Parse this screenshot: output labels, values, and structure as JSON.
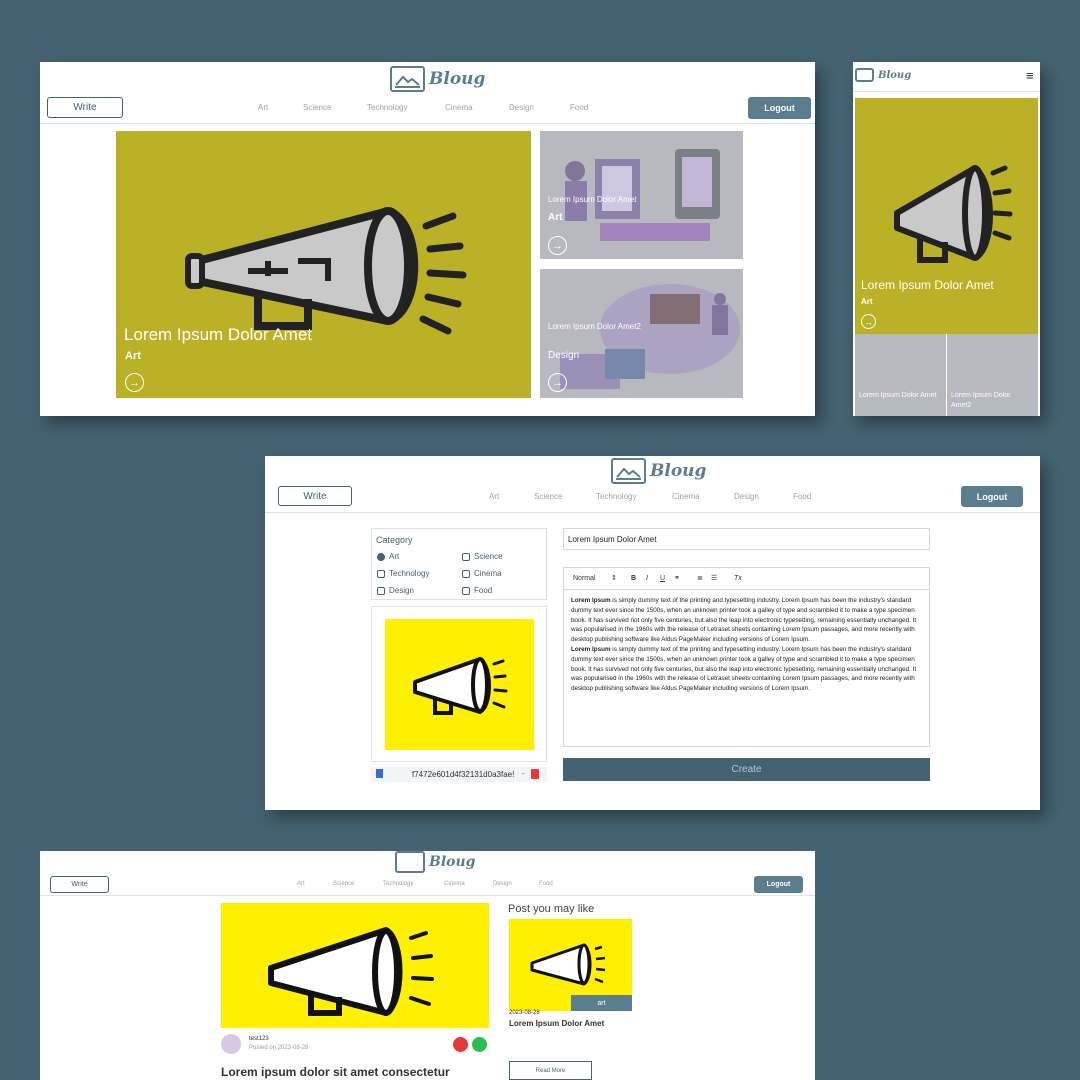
{
  "brand": {
    "name": "Bloug"
  },
  "nav": {
    "write": "Write",
    "logout": "Logout",
    "categories": [
      "Art",
      "Science",
      "Technology",
      "Cinema",
      "Design",
      "Food"
    ]
  },
  "home": {
    "hero": {
      "title": "Lorem Ipsum Dolor Amet",
      "category": "Art"
    },
    "side1": {
      "title": "Lorem Ipsum Dolor Amet",
      "category": "Art"
    },
    "side2": {
      "title": "Lorem Ipsum Dolor Amet2",
      "category": "Design"
    }
  },
  "mobile": {
    "menu_icon": "≡",
    "hero": {
      "title": "Lorem Ipsum Dolor Amet",
      "category": "Art"
    },
    "tile1": {
      "title": "Lorem Ipsum Dolor Amet"
    },
    "tile2": {
      "title": "Lorem Ipsum Dolor Amet2"
    }
  },
  "write": {
    "category_label": "Category",
    "options": [
      "Art",
      "Science",
      "Technology",
      "Cinema",
      "Design",
      "Food"
    ],
    "selected": "Art",
    "filename": "f7472e601d4f32131d0a3fae!",
    "title_value": "Lorem Ipsum Dolor Amet",
    "toolbar": {
      "format": "Normal",
      "bold": "B",
      "italic": "I",
      "underline": "U",
      "clear": "Tx"
    },
    "body_bold": "Lorem Ipsum",
    "body_text": " is simply dummy text of the printing and typesetting industry. Lorem Ipsum has been the industry's standard dummy text ever since the 1500s, when an unknown printer took a galley of type and scrambled it to make a type specimen book. It has survived not only five centuries, but also the leap into electronic typesetting, remaining essentially unchanged. It was popularised in the 1960s with the release of Letraset sheets containing Lorem Ipsum passages, and more recently with desktop publishing software like Aldus PageMaker including versions of Lorem Ipsum.",
    "create": "Create"
  },
  "post": {
    "author": "test123",
    "posted": "Posted on 2023-08-28",
    "title": "Lorem ipsum dolor sit amet consectetur",
    "suggest_heading": "Post you may like",
    "suggest_category": "art",
    "suggest_date": "2023-08-28",
    "suggest_title": "Lorem Ipsum Dolor Amet",
    "read_more": "Read More"
  },
  "colors": {
    "background": "#446272",
    "accent": "#5b7d90",
    "olive": "#bab126",
    "yellow": "#fef000",
    "delete": "#e53935",
    "edit": "#2bbd4f"
  }
}
